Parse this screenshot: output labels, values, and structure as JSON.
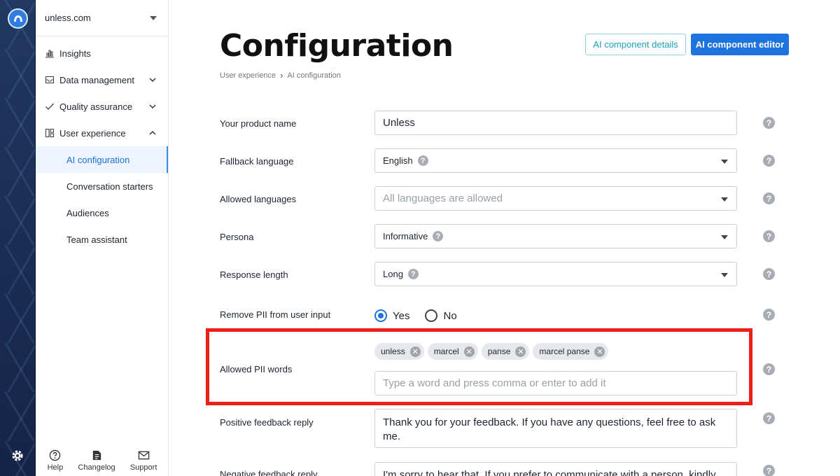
{
  "sidebar": {
    "org": "unless.com",
    "items": [
      {
        "label": "Insights"
      },
      {
        "label": "Data management"
      },
      {
        "label": "Quality assurance"
      },
      {
        "label": "User experience"
      }
    ],
    "subitems": [
      {
        "label": "AI configuration",
        "active": true
      },
      {
        "label": "Conversation starters"
      },
      {
        "label": "Audiences"
      },
      {
        "label": "Team assistant"
      }
    ],
    "bottom": {
      "help": "Help",
      "changelog": "Changelog",
      "support": "Support"
    }
  },
  "header": {
    "title": "Configuration",
    "breadcrumb": [
      "User experience",
      "AI configuration"
    ],
    "details_button": "AI component details",
    "editor_button": "AI component editor"
  },
  "form": {
    "product_name": {
      "label": "Your product name",
      "value": "Unless"
    },
    "fallback_language": {
      "label": "Fallback language",
      "value": "English"
    },
    "allowed_languages": {
      "label": "Allowed languages",
      "placeholder": "All languages are allowed"
    },
    "persona": {
      "label": "Persona",
      "value": "Informative"
    },
    "response_length": {
      "label": "Response length",
      "value": "Long"
    },
    "remove_pii": {
      "label": "Remove PII from user input",
      "yes": "Yes",
      "no": "No",
      "selected": "Yes"
    },
    "allowed_pii": {
      "label": "Allowed PII words",
      "tags": [
        "unless",
        "marcel",
        "panse",
        "marcel panse"
      ],
      "placeholder": "Type a word and press comma or enter to add it"
    },
    "positive_feedback": {
      "label": "Positive feedback reply",
      "value": "Thank you for your feedback. If you have any questions, feel free to ask me."
    },
    "negative_feedback": {
      "label": "Negative feedback reply",
      "value": "I'm sorry to hear that. If you prefer to communicate with a person, kindly"
    }
  },
  "colors": {
    "accent": "#1e74df",
    "highlight": "#ee1f14",
    "active_bg": "#edf4fd"
  }
}
